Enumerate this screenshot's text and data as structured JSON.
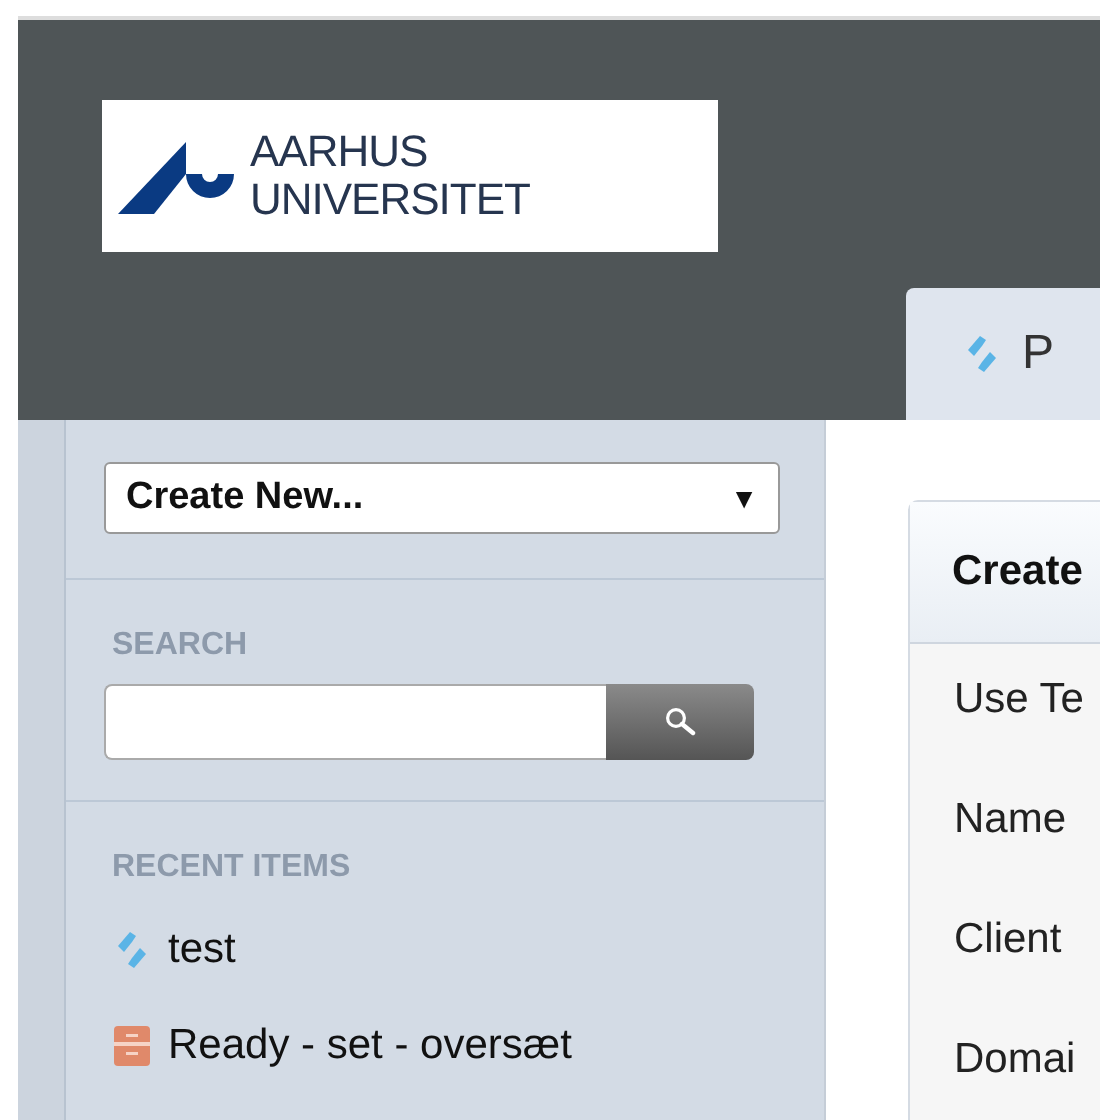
{
  "logo": {
    "lines": [
      "AARHUS",
      "UNIVERSITET"
    ]
  },
  "tabs": [
    {
      "label": "P",
      "selected": true
    }
  ],
  "sidebar": {
    "create_menu": {
      "label": "Create New...",
      "caret": "▼"
    },
    "search": {
      "heading": "SEARCH"
    },
    "recent": {
      "heading": "RECENT ITEMS",
      "items": [
        {
          "kind": "project",
          "label": "test"
        },
        {
          "kind": "archive",
          "label": "Ready - set - oversæt"
        }
      ]
    }
  },
  "panel": {
    "title": "Create",
    "fields": [
      "Use Te",
      "Name",
      "Client",
      "Domai"
    ]
  }
}
